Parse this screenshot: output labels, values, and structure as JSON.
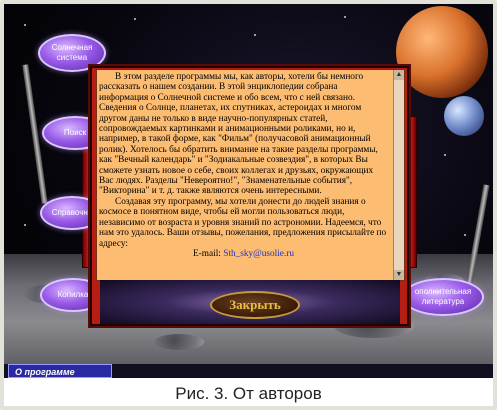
{
  "menu": {
    "solar_system": "Солнечная система",
    "search": "Поиск",
    "reference": "Справочни",
    "collection": "Копилка",
    "literature": "ополнительная литература"
  },
  "dialog": {
    "paragraph1": "В этом разделе программы мы, как авторы, хотели бы немного рассказать о нашем создании. В этой энциклопедии собрана информация о Солнечной системе и обо всем, что с ней связано. Сведения о Солнце, планетах, их спутниках, астероидах и многом другом даны не только  в виде научно-популярных статей, сопровождаемых картинками и анимационными роликами, но и, например, в такой форме, как \"Фильм\" (получасовой анимационный ролик). Хотелось бы обратить внимание на такие разделы программы, как \"Вечный календарь\" и \"Зодиакальные созвездия\", в которых Вы сможете узнать новое о себе, своих коллегах и друзьях, окружающих Вас людях. Разделы \"Невероятно!\", \"Знаменательные события\", \"Викторина\" и т. д. также являются очень интересными.",
    "paragraph2": "Создавая эту программу, мы хотели донести до людей знания о космосе в понятном виде, чтобы ей могли пользоваться люди, независимо от возраста и уровня знаний по астрономии. Надеемся, что нам это удалось. Ваши отзывы, пожелания, предложения присылайте по адресу:",
    "email_label": "E-mail:",
    "email": "Sth_sky@usolie.ru",
    "close_label": "Закрыть"
  },
  "status_bar": {
    "active_tab": "О программе"
  },
  "caption": "Рис. 3. От авторов",
  "colors": {
    "text_panel": "#fcbc72",
    "dialog_frame": "#b71d12",
    "menu_pod": "#9a5ce8",
    "link": "#1b34c4",
    "close_text": "#e8c040"
  }
}
